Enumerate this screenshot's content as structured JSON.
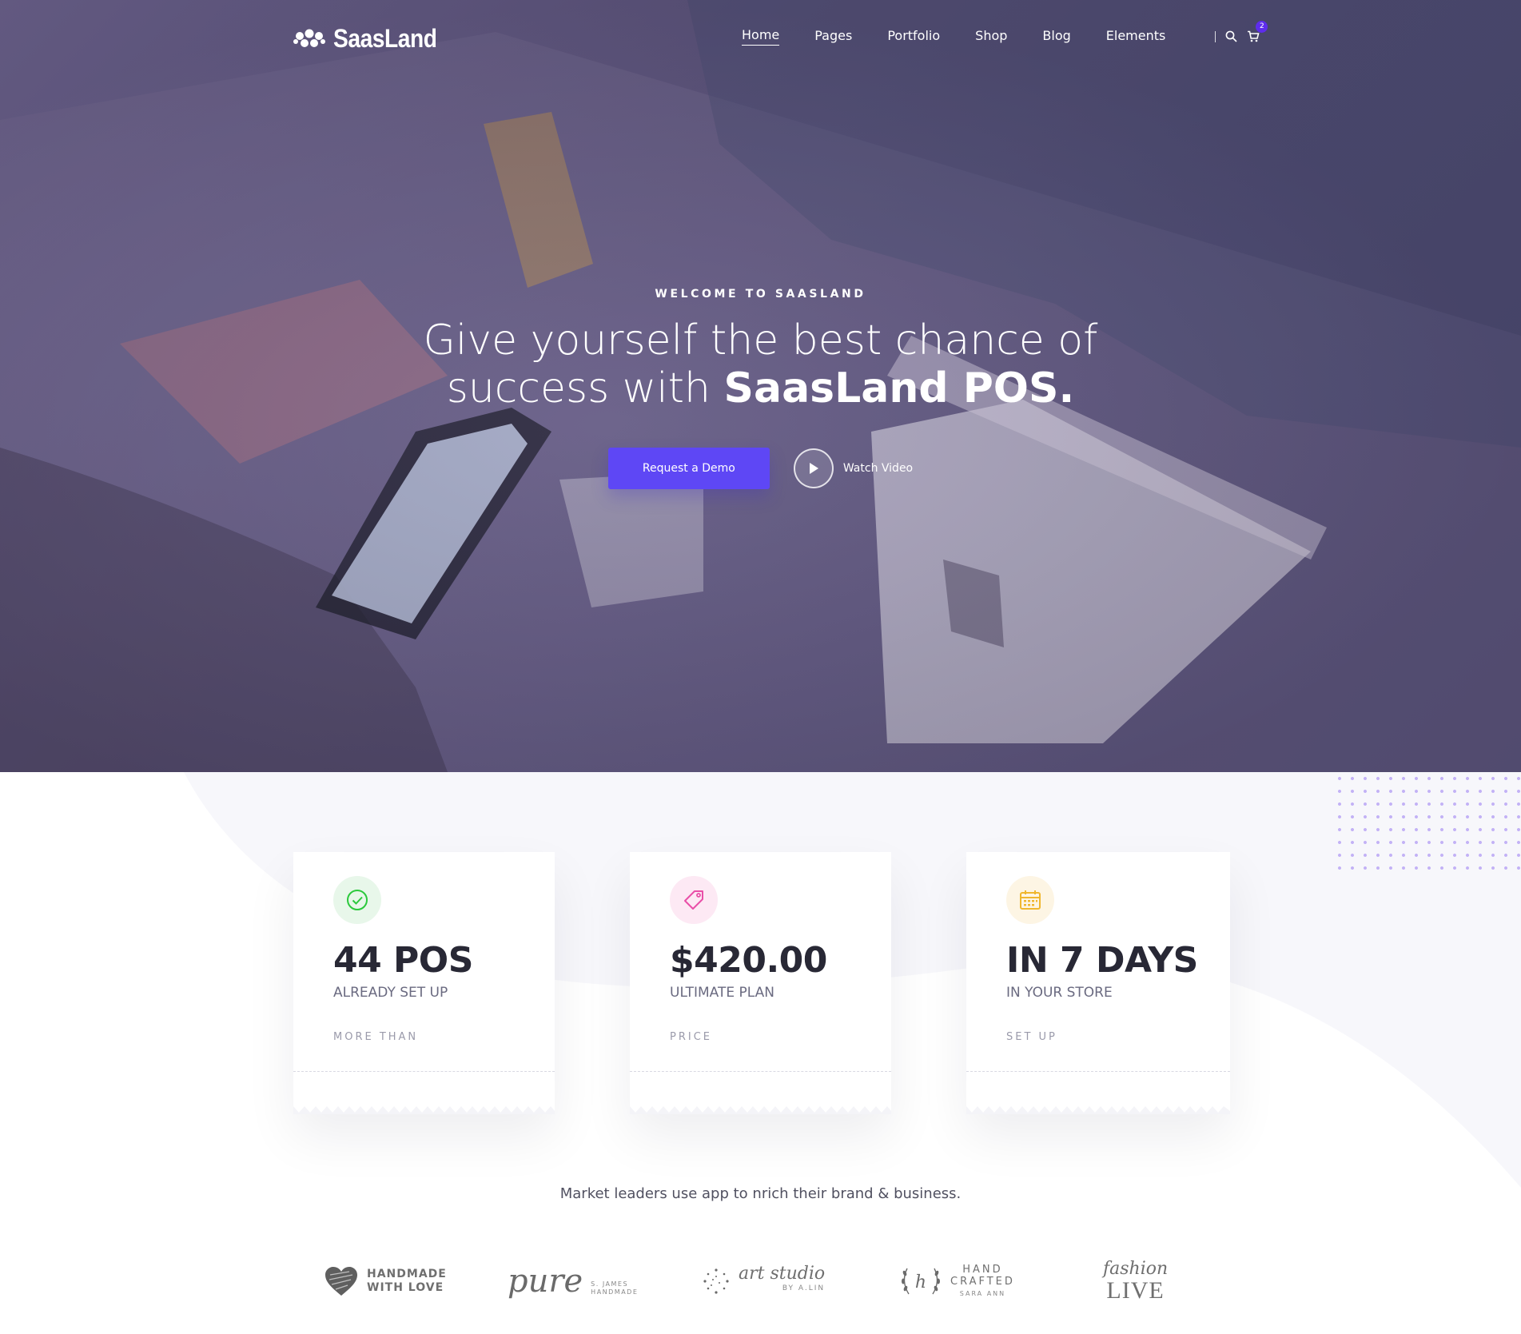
{
  "brand": {
    "name": "SaasLand"
  },
  "nav": {
    "items": [
      {
        "label": "Home",
        "active": true
      },
      {
        "label": "Pages",
        "active": false
      },
      {
        "label": "Portfolio",
        "active": false
      },
      {
        "label": "Shop",
        "active": false
      },
      {
        "label": "Blog",
        "active": false
      },
      {
        "label": "Elements",
        "active": false
      }
    ],
    "search_icon": "search-icon",
    "cart_icon": "cart-icon",
    "cart_count": "2"
  },
  "hero": {
    "eyebrow": "WELCOME TO SAASLAND",
    "headline_line1": "Give yourself the best chance of",
    "headline_line2_regular": "success with ",
    "headline_line2_bold": "SaasLand POS.",
    "demo_button": "Request a Demo",
    "watch_label": "Watch Video"
  },
  "cards": [
    {
      "icon": "check-circle-icon",
      "icon_color": "#2bc93c",
      "icon_bg": "#e8f7ea",
      "value": "44 POS",
      "subtitle": "ALREADY SET UP",
      "label": "MORE THAN"
    },
    {
      "icon": "tag-icon",
      "icon_color": "#e94fa8",
      "icon_bg": "#fde9f4",
      "value": "$420.00",
      "subtitle": "ULTIMATE PLAN",
      "label": "PRICE"
    },
    {
      "icon": "calendar-icon",
      "icon_color": "#f0b72f",
      "icon_bg": "#fdf5e4",
      "value": "IN 7 DAYS",
      "subtitle": "IN YOUR STORE",
      "label": "SET UP"
    }
  ],
  "leaders_text": "Market leaders use app to nrich their brand & business.",
  "partner_logos": [
    {
      "line1": "HANDMADE",
      "line2": "WITH LOVE"
    },
    {
      "line1": "pure",
      "line2": "S. JAMES HANDMADE"
    },
    {
      "line1": "art studio",
      "line2": "BY A.LIN"
    },
    {
      "line1": "HAND",
      "line2": "CRAFTED",
      "line3": "SARA ANN"
    },
    {
      "line1": "fashion",
      "line2": "LIVE"
    }
  ],
  "colors": {
    "accent": "#5e47f5",
    "hero_overlay": "#5f5680",
    "heading": "#282835"
  }
}
